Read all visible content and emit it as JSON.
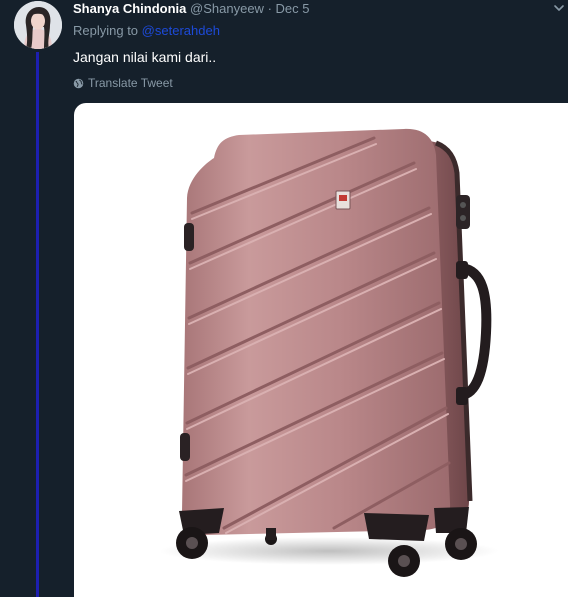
{
  "tweet": {
    "author_name": "Shanya Chindonia",
    "author_handle": "@Shanyeew",
    "separator": "·",
    "date": "Dec 5",
    "replying_prefix": "Replying to",
    "replying_handle": "@seterahdeh",
    "text": "Jangan nilai kami dari..",
    "translate_label": "Translate Tweet"
  },
  "icons": {
    "caret": "chevron-down-icon",
    "translate": "globe-icon"
  },
  "colors": {
    "background": "#15202b",
    "thread_line": "#1d1fb0",
    "link": "#1d4ad8",
    "muted": "#8899a6",
    "suitcase": "#b98a8c"
  }
}
